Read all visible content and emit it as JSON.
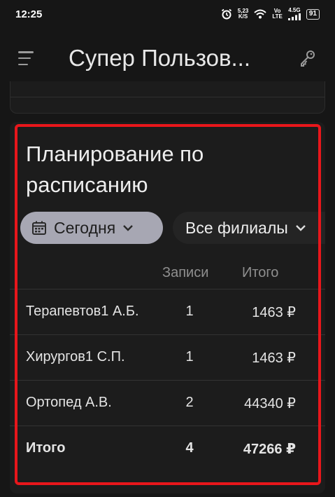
{
  "status_bar": {
    "time": "12:25",
    "net_speed_value": "5,23",
    "net_speed_unit": "K/S",
    "vo_lte_top": "Vo",
    "vo_lte_bottom": "LTE",
    "network": "4.5G",
    "battery": "91"
  },
  "app_bar": {
    "title": "Супер Пользов..."
  },
  "card": {
    "title": "Планирование по расписанию",
    "date_filter": "Сегодня",
    "branch_filter": "Все филиалы",
    "columns": [
      "Записи",
      "Итого"
    ],
    "rows": [
      {
        "name": "Терапевтов1 А.Б.",
        "count": "1",
        "total": "1463 ₽"
      },
      {
        "name": "Хирургов1 С.П.",
        "count": "1",
        "total": "1463 ₽"
      },
      {
        "name": "Ортопед А.В.",
        "count": "2",
        "total": "44340 ₽"
      }
    ],
    "summary": {
      "name": "Итого",
      "count": "4",
      "total": "47266 ₽"
    }
  },
  "colors": {
    "background": "#161616",
    "card": "#1c1c1c",
    "chip_active": "#a7a7b3",
    "highlight": "#e8161b"
  }
}
